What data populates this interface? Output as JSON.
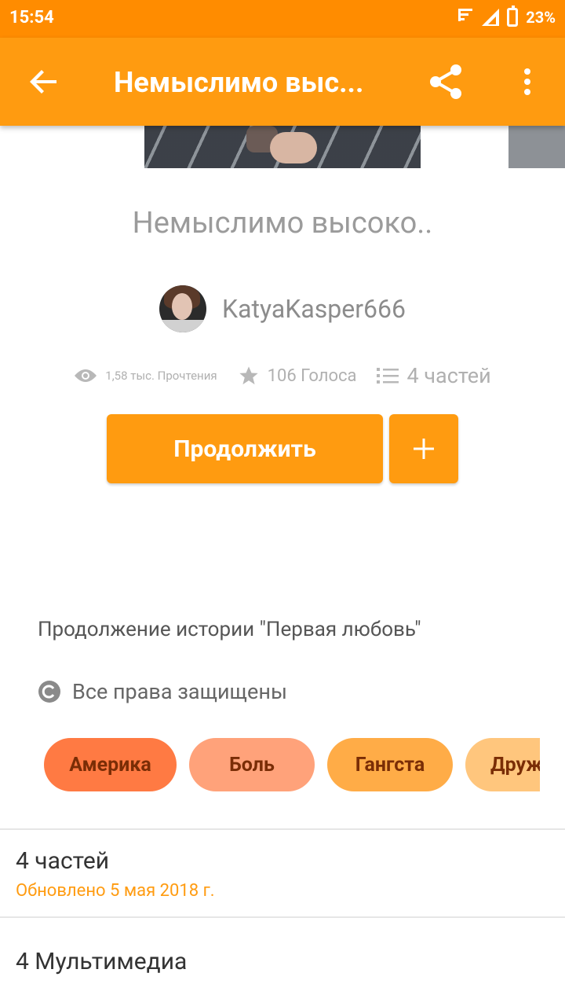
{
  "status_bar": {
    "time": "15:54",
    "battery": "23%"
  },
  "app_bar": {
    "title": "Немыслимо выс..."
  },
  "story": {
    "title": "Немыслимо высоко..",
    "author": "KatyaKasper666",
    "stats": {
      "reads": "1,58 тыс. Прочтения",
      "votes": "106 Голоса",
      "parts": "4 частей"
    },
    "continue_label": "Продолжить",
    "add_label": "+",
    "description": "Продолжение истории \"Первая любовь\"",
    "copyright": "Все права защищены",
    "tags": [
      "Америка",
      "Боль",
      "Гангста",
      "Друж"
    ]
  },
  "sections": {
    "parts_title": "4 частей",
    "parts_updated": "Обновлено 5 мая 2018 г.",
    "media_title": "4 Мультимедиа"
  },
  "colors": {
    "accent": "#ff9b10",
    "status_bar": "#ff8c00",
    "tag_colors": [
      "#ff7a43",
      "#ffa27a",
      "#ffac47",
      "#ffc67d"
    ]
  }
}
